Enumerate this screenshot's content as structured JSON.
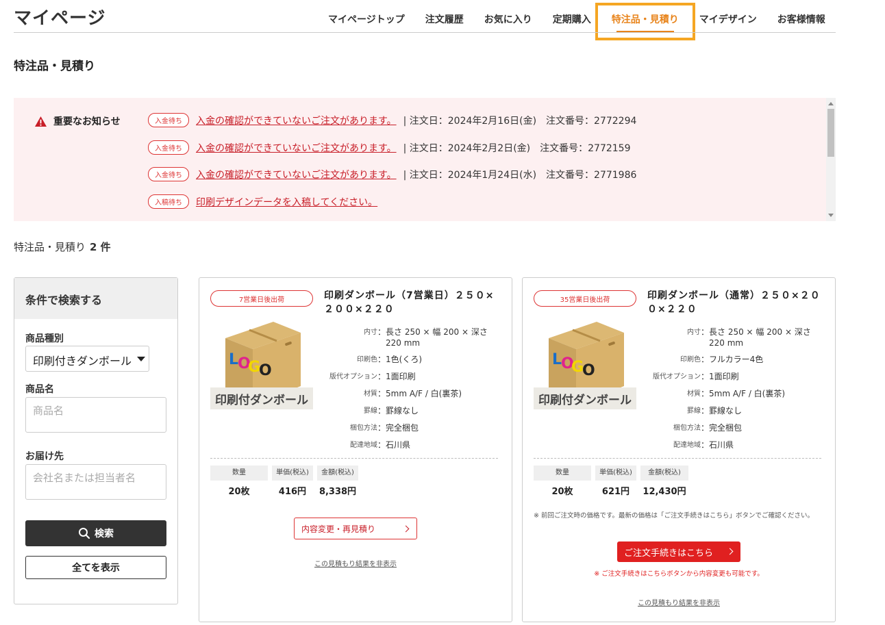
{
  "header": {
    "title": "マイページ",
    "nav": [
      {
        "label": "マイページトップ",
        "active": false
      },
      {
        "label": "注文履歴",
        "active": false
      },
      {
        "label": "お気に入り",
        "active": false
      },
      {
        "label": "定期購入",
        "active": false
      },
      {
        "label": "特注品・見積り",
        "active": true
      },
      {
        "label": "マイデザイン",
        "active": false
      },
      {
        "label": "お客様情報",
        "active": false
      }
    ]
  },
  "section_title": "特注品・見積り",
  "notice": {
    "heading": "重要なお知らせ",
    "items": [
      {
        "badge": "入金待ち",
        "link": "入金の確認ができていないご注文があります。",
        "meta": "|  注文日：2024年2月16日(金)　注文番号：2772294"
      },
      {
        "badge": "入金待ち",
        "link": "入金の確認ができていないご注文があります。",
        "meta": "|  注文日：2024年2月2日(金)　注文番号：2772159"
      },
      {
        "badge": "入金待ち",
        "link": "入金の確認ができていないご注文があります。",
        "meta": "|  注文日：2024年1月24日(水)　注文番号：2771986"
      },
      {
        "badge": "入稿待ち",
        "link": "印刷デザインデータを入稿してください。",
        "meta": ""
      }
    ]
  },
  "count": {
    "label": "特注品・見積り",
    "value": "2 件"
  },
  "sidebar": {
    "heading": "条件で検索する",
    "type_label": "商品種別",
    "type_value": "印刷付きダンボール",
    "name_label": "商品名",
    "name_placeholder": "商品名",
    "dest_label": "お届け先",
    "dest_placeholder": "会社名または担当者名",
    "search_label": "検索",
    "show_all_label": "全てを表示"
  },
  "cards": [
    {
      "ship_badge": "7営業日後出荷",
      "image_caption": "印刷付ダンボール",
      "title": "印刷ダンボール（7営業日）２５０×２００×２２０",
      "specs": [
        {
          "key": "内寸",
          "value": "長さ 250 × 幅 200 × 深さ 220 mm"
        },
        {
          "key": "印刷色",
          "value": "1色(くろ)"
        },
        {
          "key": "版代オプション",
          "value": "1面印刷"
        },
        {
          "key": "材質",
          "value": "5mm A/F / 白(裏茶)"
        },
        {
          "key": "罫線",
          "value": "罫線なし"
        },
        {
          "key": "梱包方法",
          "value": "完全梱包"
        },
        {
          "key": "配達地域",
          "value": "石川県"
        }
      ],
      "price_headers": [
        "数量",
        "単価(税込)",
        "金額(税込)"
      ],
      "price_values": [
        "20枚",
        "416円",
        "8,338円"
      ],
      "action_label": "内容変更・再見積り",
      "hide_label": "この見積もり結果を非表示"
    },
    {
      "ship_badge": "35営業日後出荷",
      "image_caption": "印刷付ダンボール",
      "title": "印刷ダンボール（通常）２５０×２００×２２０",
      "specs": [
        {
          "key": "内寸",
          "value": "長さ 250 × 幅 200 × 深さ 220 mm"
        },
        {
          "key": "印刷色",
          "value": "フルカラー4色"
        },
        {
          "key": "版代オプション",
          "value": "1面印刷"
        },
        {
          "key": "材質",
          "value": "5mm A/F / 白(裏茶)"
        },
        {
          "key": "罫線",
          "value": "罫線なし"
        },
        {
          "key": "梱包方法",
          "value": "完全梱包"
        },
        {
          "key": "配達地域",
          "value": "石川県"
        }
      ],
      "price_headers": [
        "数量",
        "単価(税込)",
        "金額(税込)"
      ],
      "price_values": [
        "20枚",
        "621円",
        "12,430円"
      ],
      "note": "※ 前回ご注文時の価格です。最新の価格は「ご注文手続きはこちら」ボタンでご確認ください。",
      "order_label": "ご注文手続きはこちら",
      "order_note": "※ ご注文手続きはこちらボタンから内容変更も可能です。",
      "hide_label": "この見積もり結果を非表示"
    }
  ],
  "icons": {
    "warning": "warning-triangle-icon",
    "search": "search-icon",
    "chevron": "chevron-right-icon",
    "dropdown": "caret-down-icon"
  },
  "colors": {
    "accent": "#e8841b",
    "highlight": "#f5a623",
    "alert_red": "#c81e28",
    "notice_bg": "#fdf0f1",
    "button_dark": "#333333",
    "button_red": "#e02020"
  }
}
